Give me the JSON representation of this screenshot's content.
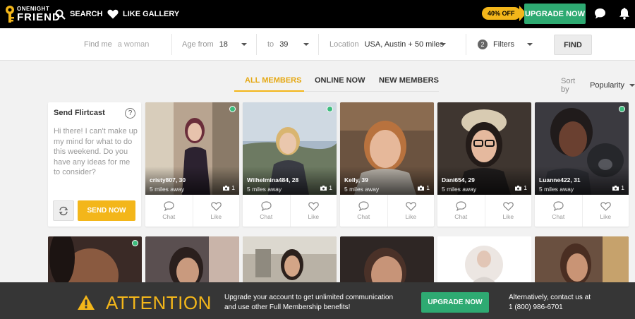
{
  "brand": {
    "line1": "ONENIGHT",
    "line2": "FRIEND"
  },
  "nav": {
    "search": "SEARCH",
    "gallery": "LIKE GALLERY"
  },
  "promo": {
    "badge": "40% OFF",
    "upgrade": "UPGRADE NOW"
  },
  "filters": {
    "find_me_label": "Find me",
    "find_me_placeholder": "a woman",
    "age_from_label": "Age from",
    "age_from": "18",
    "age_to_label": "to",
    "age_to": "39",
    "location_label": "Location",
    "location": "USA, Austin + 50 miles",
    "filters_count": "2",
    "filters_label": "Filters",
    "find": "FIND"
  },
  "tabs": [
    {
      "label": "ALL MEMBERS",
      "active": true
    },
    {
      "label": "ONLINE NOW",
      "active": false
    },
    {
      "label": "NEW MEMBERS",
      "active": false
    }
  ],
  "sort": {
    "label": "Sort by",
    "value": "Popularity"
  },
  "flirtcast": {
    "title": "Send Flirtcast",
    "help": "?",
    "message": "Hi there! I can't make up my mind for what to do this weekend. Do you have any ideas for me to consider?",
    "send": "SEND NOW"
  },
  "members": [
    {
      "name": "cristy807",
      "age": "30",
      "distance": "5 miles away",
      "photos": "1",
      "online": true
    },
    {
      "name": "Wilhelmina484",
      "age": "28",
      "distance": "5 miles away",
      "photos": "1",
      "online": true
    },
    {
      "name": "Kelly",
      "age": "39",
      "distance": "5 miles away",
      "photos": "1",
      "online": false
    },
    {
      "name": "Dani654",
      "age": "29",
      "distance": "5 miles away",
      "photos": "1",
      "online": false
    },
    {
      "name": "Luanne422",
      "age": "31",
      "distance": "5 miles away",
      "photos": "1",
      "online": true
    }
  ],
  "actions": {
    "chat": "Chat",
    "like": "Like"
  },
  "attention": {
    "title": "ATTENTION",
    "line1": "Upgrade your account to get unlimited communication",
    "line2": "and use other Full Membership benefits!",
    "button": "UPGRADE NOW",
    "contact1": "Alternatively, contact us at",
    "contact2": "1 (800) 986-6701"
  },
  "colors": {
    "accent": "#f3b61a",
    "green": "#2eaa72",
    "online": "#3cbc7c",
    "bar": "#363636"
  }
}
